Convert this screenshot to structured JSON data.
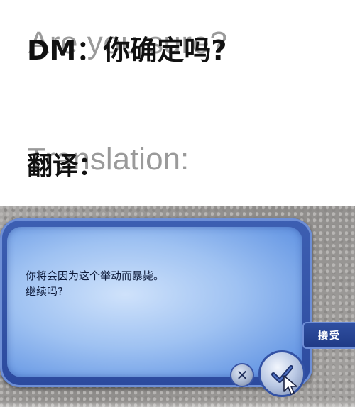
{
  "caption": {
    "line1": "DM：你确定吗?",
    "line1_ghost": "Are you sure?",
    "line2": "翻译：",
    "line2_ghost": "Translation:"
  },
  "dialog": {
    "message_line1": "你将会因为这个举动而暴毙。",
    "message_line2": "继续吗?",
    "accept_label": "接受",
    "cancel_symbol": "✕",
    "confirm_icon": "check-icon",
    "colors": {
      "frame": "#2c4a9e",
      "panel": "#9fc2f2",
      "text": "#0d1a3a"
    }
  }
}
